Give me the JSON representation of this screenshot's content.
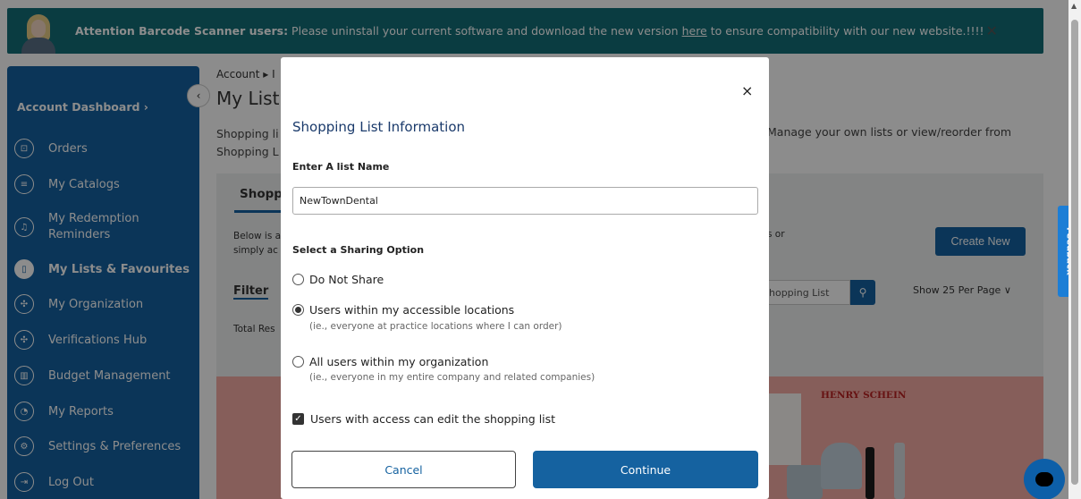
{
  "banner": {
    "bold": "Attention Barcode Scanner users:",
    "text_before_link": " Please uninstall your current software and download the new version ",
    "link": "here",
    "text_after_link": " to ensure compatibility with our new website.!!!!",
    "close": "✕"
  },
  "sidebar": {
    "title": "Account Dashboard ›",
    "collapse": "‹",
    "items": [
      {
        "label": "Orders",
        "icon": "bag-icon",
        "glyph": "⊡"
      },
      {
        "label": "My Catalogs",
        "icon": "catalog-icon",
        "glyph": "≡"
      },
      {
        "label": "My Redemption",
        "label2": "Reminders",
        "icon": "bell-icon",
        "glyph": "♫"
      },
      {
        "label": "My Lists & Favourites",
        "icon": "bookmark-icon",
        "glyph": "▯",
        "active": true
      },
      {
        "label": "My Organization",
        "icon": "org-icon",
        "glyph": "✣"
      },
      {
        "label": "Verifications Hub",
        "icon": "hub-icon",
        "glyph": "✣"
      },
      {
        "label": "Budget Management",
        "icon": "budget-icon",
        "glyph": "▥"
      },
      {
        "label": "My Reports",
        "icon": "reports-icon",
        "glyph": "◔"
      },
      {
        "label": "Settings & Preferences",
        "icon": "gear-icon",
        "glyph": "⚙"
      },
      {
        "label": "Log Out",
        "icon": "logout-icon",
        "glyph": "⇥"
      }
    ]
  },
  "page": {
    "breadcrumb": "Account ▸ I",
    "title": "My List",
    "desc_line1": "Shopping li",
    "desc_line2": "Shopping L",
    "desc_right": "Manage your own lists or view/reorder from",
    "tab": "Shopp",
    "below_line1": "Below is a",
    "below_line2": "simply ac",
    "or_text": "s or",
    "create_button": "Create New",
    "filter": "Filter",
    "search_placeholder": "hopping List",
    "show": "Show  25 Per Page  ∨",
    "total": "Total Res",
    "brand": "HENRY SCHEIN",
    "feedback": "Feedback"
  },
  "modal": {
    "close": "×",
    "title": "Shopping List Information",
    "name_label": "Enter A list Name",
    "name_value": "NewTownDental",
    "share_label": "Select a Sharing Option",
    "options": [
      {
        "label": "Do Not Share",
        "hint": "",
        "selected": false
      },
      {
        "label": "Users within my accessible locations",
        "hint": "(ie., everyone at practice locations where I can order)",
        "selected": true
      },
      {
        "label": "All users within my organization",
        "hint": "(ie., everyone in my entire company and related companies)",
        "selected": false
      }
    ],
    "edit_checkbox": {
      "label": "Users with access can edit the shopping list",
      "checked": true
    },
    "cancel": "Cancel",
    "continue": "Continue"
  },
  "colors": {
    "banner": "#136d77",
    "primary": "#1562a0",
    "promo": "#f4aba4"
  }
}
